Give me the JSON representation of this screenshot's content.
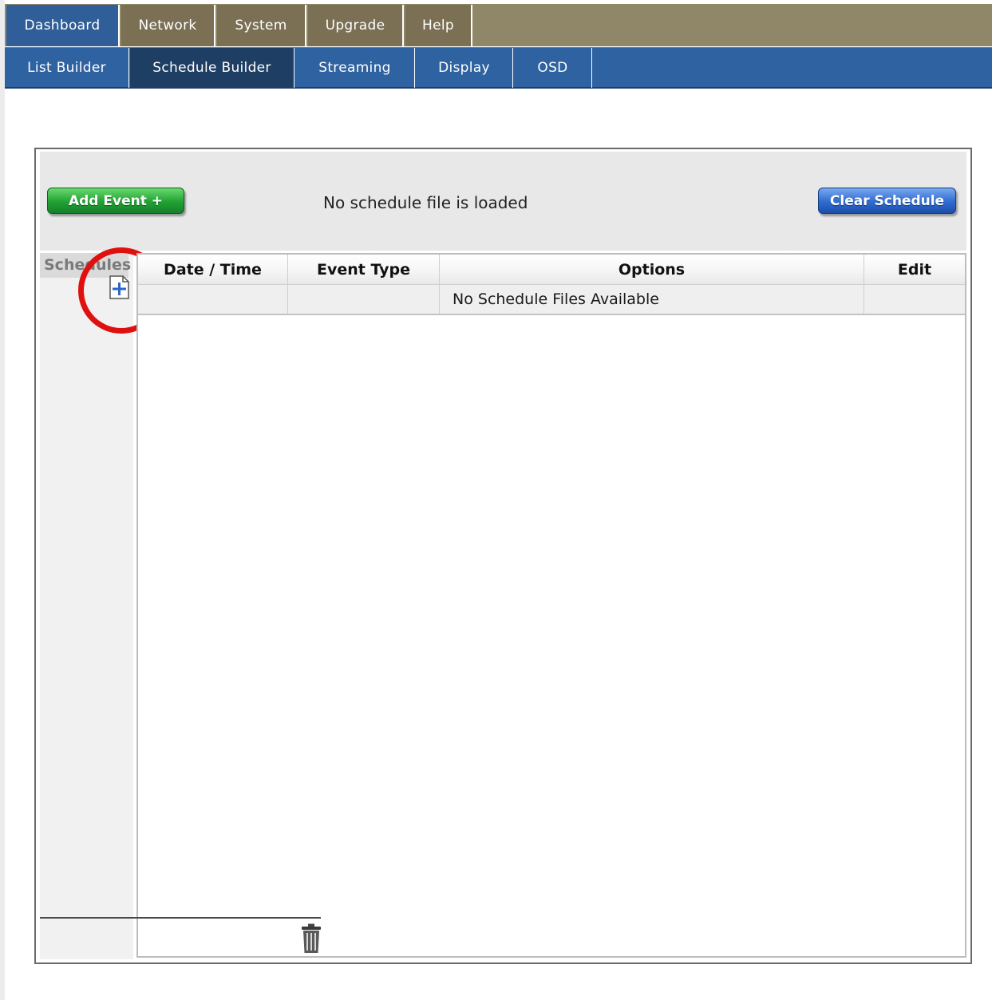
{
  "top_nav": {
    "tabs": [
      {
        "label": "Dashboard",
        "active": true
      },
      {
        "label": "Network",
        "active": false
      },
      {
        "label": "System",
        "active": false
      },
      {
        "label": "Upgrade",
        "active": false
      },
      {
        "label": "Help",
        "active": false
      }
    ]
  },
  "sub_nav": {
    "tabs": [
      {
        "label": "List Builder",
        "active": false
      },
      {
        "label": "Schedule Builder",
        "active": true
      },
      {
        "label": "Streaming",
        "active": false
      },
      {
        "label": "Display",
        "active": false
      },
      {
        "label": "OSD",
        "active": false
      }
    ]
  },
  "toolbar": {
    "add_event_label": "Add Event +",
    "status_text": "No schedule file is loaded",
    "clear_schedule_label": "Clear Schedule"
  },
  "sidebar": {
    "title": "Schedules",
    "add_icon": "add-file-icon",
    "delete_icon": "trash-icon"
  },
  "table": {
    "columns": [
      "Date / Time",
      "Event Type",
      "Options",
      "Edit"
    ],
    "rows": [
      [
        "",
        "",
        "No Schedule Files Available",
        ""
      ]
    ]
  },
  "colors": {
    "top_nav_bg": "#8f8768",
    "top_nav_active": "#2f5e98",
    "sub_nav_bg": "#2f62a0",
    "sub_nav_active": "#1f3e63",
    "add_button": "#21a133",
    "clear_button": "#2f6bd0",
    "highlight_circle": "#e01010"
  }
}
